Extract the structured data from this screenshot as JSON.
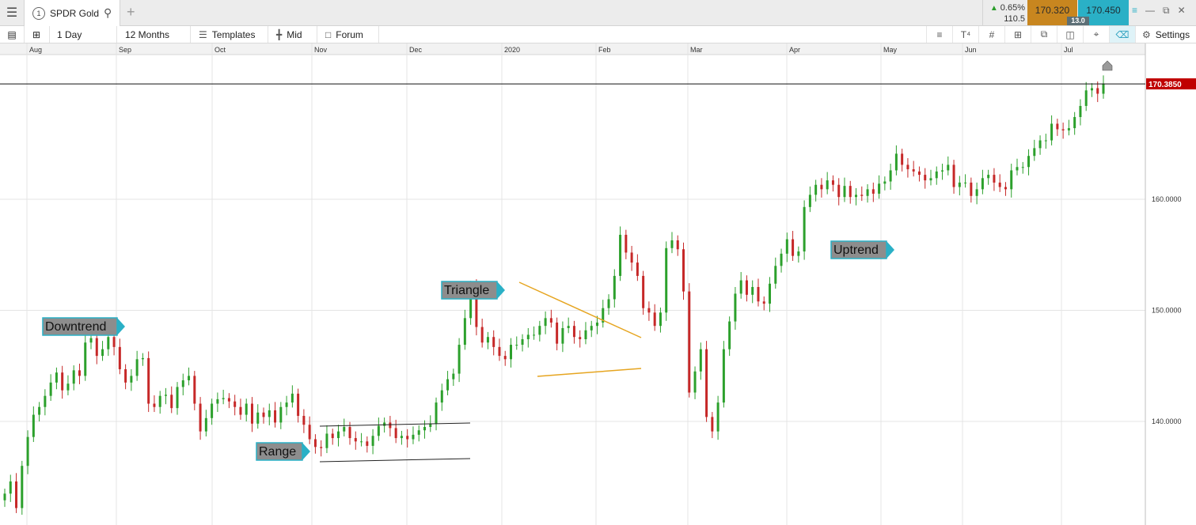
{
  "tabbar": {
    "menu_icon": "hamburger-menu-icon",
    "tab_number": "1",
    "tab_label": "SPDR Gold",
    "add_icon": "plus-icon"
  },
  "quote": {
    "change_pct": "0.65%",
    "change_value": "110.5",
    "sell": "170.320",
    "buy": "170.450",
    "spread": "13.0",
    "sell_color": "#c8861f",
    "buy_color": "#2ab0c6"
  },
  "toolbar": {
    "interval": "1 Day",
    "range": "12 Months",
    "templates": "Templates",
    "price_type": "Mid",
    "forum": "Forum",
    "settings": "Settings"
  },
  "chart_data": {
    "type": "candlestick",
    "months": [
      "Aug",
      "Sep",
      "Oct",
      "Nov",
      "Dec",
      "2020",
      "Feb",
      "Mar",
      "Apr",
      "May",
      "Jun",
      "Jul"
    ],
    "y_ticks": [
      "160.0000",
      "150.0000",
      "140.0000"
    ],
    "ylim": [
      127.5,
      173.5
    ],
    "current_price": "170.3850",
    "current_price_color": "#c00000",
    "up_color": "#2ca02c",
    "down_color": "#c62828",
    "close": [
      133.5,
      134.6,
      132.2,
      136,
      138.6,
      140.6,
      141.3,
      142.3,
      143.5,
      144.4,
      142.8,
      143.4,
      144.6,
      144.1,
      147.1,
      147.5,
      145.9,
      146.5,
      147.6,
      146.7,
      144.7,
      143.5,
      144.1,
      145.6,
      145.7,
      141.6,
      141.3,
      142.3,
      142.4,
      141.2,
      143.1,
      143.7,
      144.1,
      141.6,
      139.1,
      140.3,
      141.6,
      142,
      142.1,
      141.8,
      141.3,
      140.6,
      141.6,
      139.8,
      140.8,
      140.4,
      141,
      139.9,
      141.3,
      141.7,
      142.5,
      140.5,
      139.7,
      138.4,
      137.7,
      137.6,
      138.9,
      138.5,
      139.1,
      139.5,
      138.5,
      138.2,
      138.2,
      137.8,
      138.7,
      139.6,
      139.9,
      139.4,
      138.5,
      138.7,
      138.4,
      138.8,
      139.2,
      139.5,
      139.8,
      141.7,
      142.8,
      143.8,
      144.3,
      146.9,
      149.3,
      152.2,
      148.5,
      147.1,
      147.6,
      146.7,
      145.9,
      145.6,
      146.9,
      146.9,
      147.4,
      147.8,
      147.8,
      148.6,
      149.3,
      148.9,
      147,
      148.4,
      148.6,
      147.6,
      147.4,
      148.2,
      148.6,
      148.9,
      150.2,
      151,
      153.1,
      156.8,
      155.2,
      154.3,
      153.1,
      150.2,
      149.8,
      148.6,
      149.8,
      155.6,
      156.3,
      155.5,
      151.7,
      142.6,
      144.5,
      146.5,
      140.4,
      139.1,
      141.7,
      146.5,
      149,
      151.5,
      152.7,
      151.4,
      152.1,
      150.8,
      150.6,
      152.4,
      154,
      155.1,
      156.4,
      154.9,
      155.3,
      159.3,
      160.4,
      161.3,
      160.9,
      161.7,
      161.3,
      160.2,
      161.2,
      160.2,
      160.4,
      160.3,
      160.9,
      160.5,
      161.4,
      161.6,
      162.6,
      164.1,
      163.1,
      162.7,
      162.5,
      162.2,
      161.7,
      161.9,
      162.5,
      162.6,
      163.1,
      161.1,
      161.5,
      161.5,
      160.3,
      160.9,
      161.9,
      162.2,
      161.5,
      161.1,
      160.9,
      162.6,
      162.9,
      162.9,
      163.9,
      164.6,
      165.3,
      165.3,
      166.8,
      166.3,
      166.2,
      166.4,
      167.4,
      168.4,
      169.8,
      170,
      169.5,
      170.4
    ],
    "annotations": [
      {
        "label": "Downtrend"
      },
      {
        "label": "Range"
      },
      {
        "label": "Triangle"
      },
      {
        "label": "Uptrend"
      }
    ]
  }
}
